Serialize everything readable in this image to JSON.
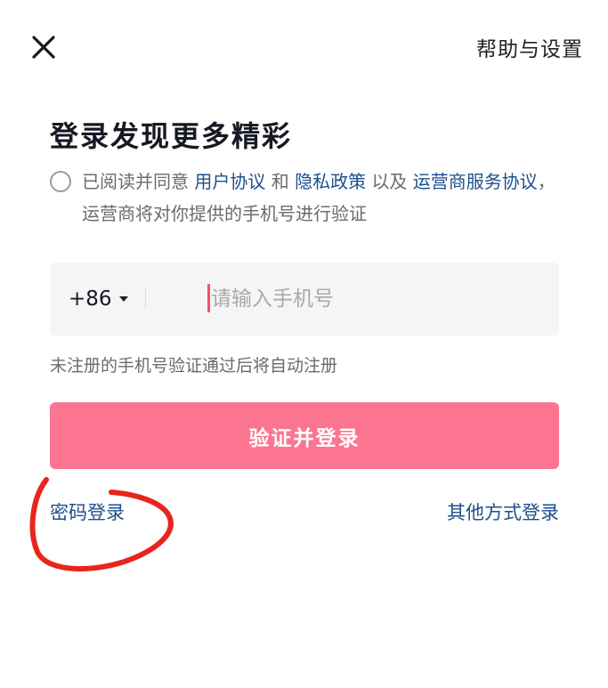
{
  "header": {
    "close_icon": "close-icon",
    "help_label": "帮助与设置"
  },
  "title": "登录发现更多精彩",
  "agreement": {
    "prefix": "已阅读并同意 ",
    "user_agreement": "用户协议",
    "and": " 和 ",
    "privacy_policy": "隐私政策",
    "and_also": " 以及 ",
    "carrier_service": "运营商服务协议",
    "suffix": "，运营商将对你提供的手机号进行验证"
  },
  "phone": {
    "country_code": "+86",
    "placeholder": "请输入手机号",
    "value": ""
  },
  "hint": "未注册的手机号验证通过后将自动注册",
  "login_button": "验证并登录",
  "password_login": "密码登录",
  "other_login": "其他方式登录",
  "colors": {
    "primary_button": "#fb7591",
    "link": "#1d4f8c",
    "cursor": "#f2506a",
    "annotation": "#e8251c"
  }
}
